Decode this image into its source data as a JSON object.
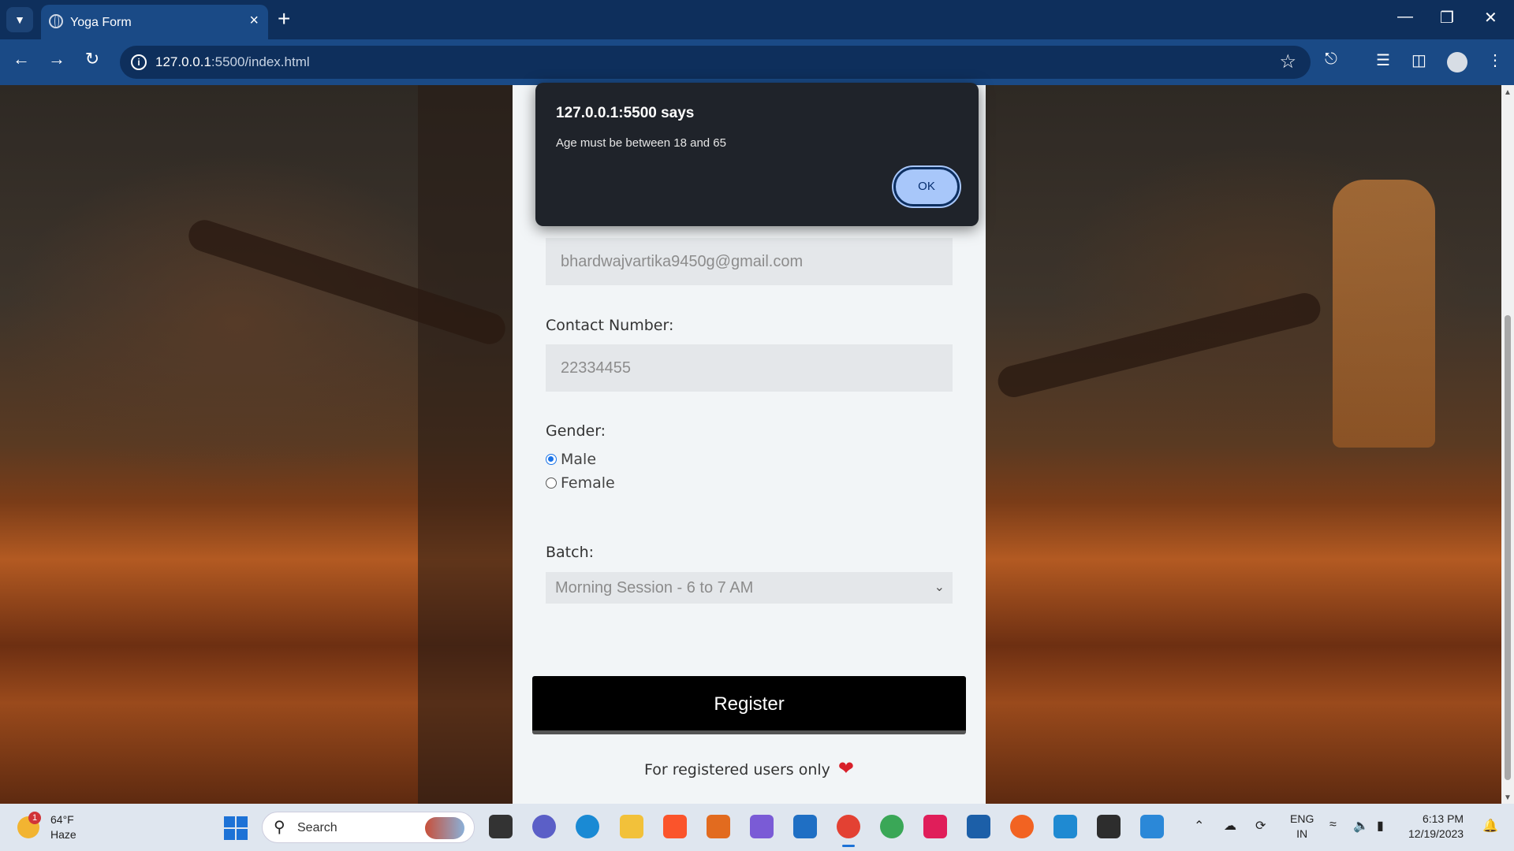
{
  "browser": {
    "tab_title": "Yoga Form",
    "url_host": "127.0.0.1",
    "url_path": ":5500/index.html",
    "icons": [
      "tab-search-icon",
      "globe-icon",
      "close-icon",
      "new-tab-icon",
      "minimize-icon",
      "restore-icon",
      "window-close-icon",
      "back-icon",
      "forward-icon",
      "reload-icon",
      "site-info-icon",
      "bookmark-star-icon",
      "extensions-icon",
      "media-icon",
      "side-panel-icon",
      "profile-avatar",
      "menu-icon"
    ]
  },
  "form": {
    "email_value": "bhardwajvartika9450g@gmail.com",
    "contact_label": "Contact Number:",
    "contact_value": "22334455",
    "gender_label": "Gender:",
    "gender_options": [
      "Male",
      "Female"
    ],
    "gender_selected": "Male",
    "batch_label": "Batch:",
    "batch_value": "Morning Session - 6 to 7 AM",
    "register_label": "Register",
    "footnote": "For registered users only"
  },
  "dialog": {
    "title": "127.0.0.1:5500 says",
    "message": "Age must be between 18 and 65",
    "ok_label": "OK"
  },
  "taskbar": {
    "weather_temp": "64°F",
    "weather_cond": "Haze",
    "weather_badge": "1",
    "search_label": "Search",
    "lang_line1": "ENG",
    "lang_line2": "IN",
    "time": "6:13 PM",
    "date": "12/19/2023"
  },
  "colors": {
    "chrome_dark": "#0e2f5c",
    "chrome_toolbar": "#1a4a86",
    "dialog_bg": "#1f232a",
    "ok_button": "#a8c7fa",
    "register_bg": "#000000",
    "heart": "#d8202a"
  }
}
